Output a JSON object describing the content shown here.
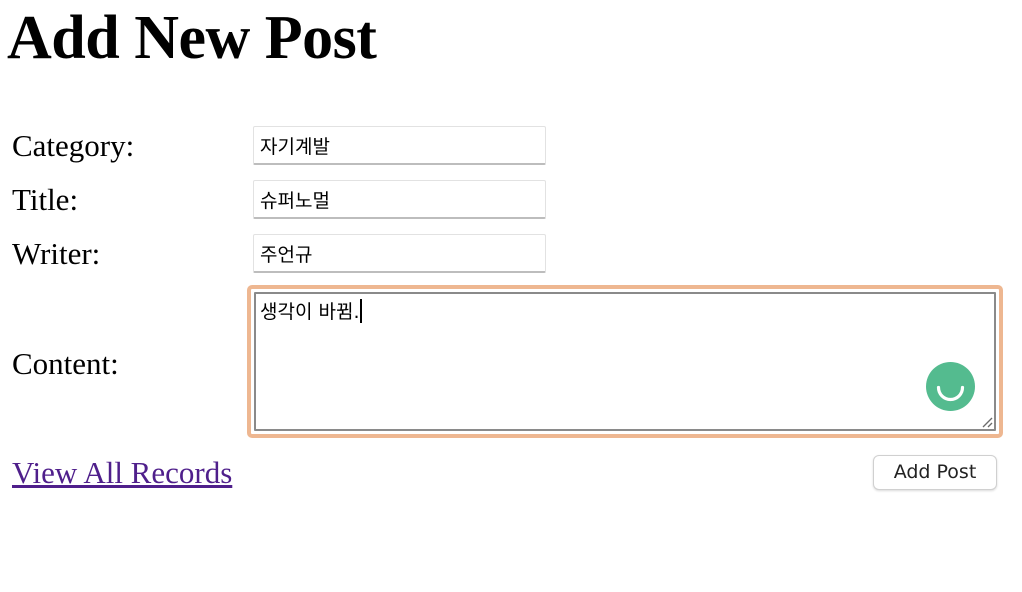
{
  "page": {
    "title": "Add New Post"
  },
  "form": {
    "category": {
      "label": "Category:",
      "value": "자기계발"
    },
    "title": {
      "label": "Title:",
      "value": "슈퍼노멀"
    },
    "writer": {
      "label": "Writer:",
      "value": "주언규"
    },
    "content": {
      "label": "Content:",
      "value": "생각이 바뀜."
    },
    "submit_label": "Add Post"
  },
  "links": {
    "view_all": "View All Records"
  },
  "colors": {
    "focus_ring": "#eeb791",
    "link_visited": "#4f1f8b",
    "assistant_badge": "#54bb8f"
  },
  "icons": {
    "assistant_badge": "smile-icon",
    "resize_grip": "resize-grip-icon"
  }
}
